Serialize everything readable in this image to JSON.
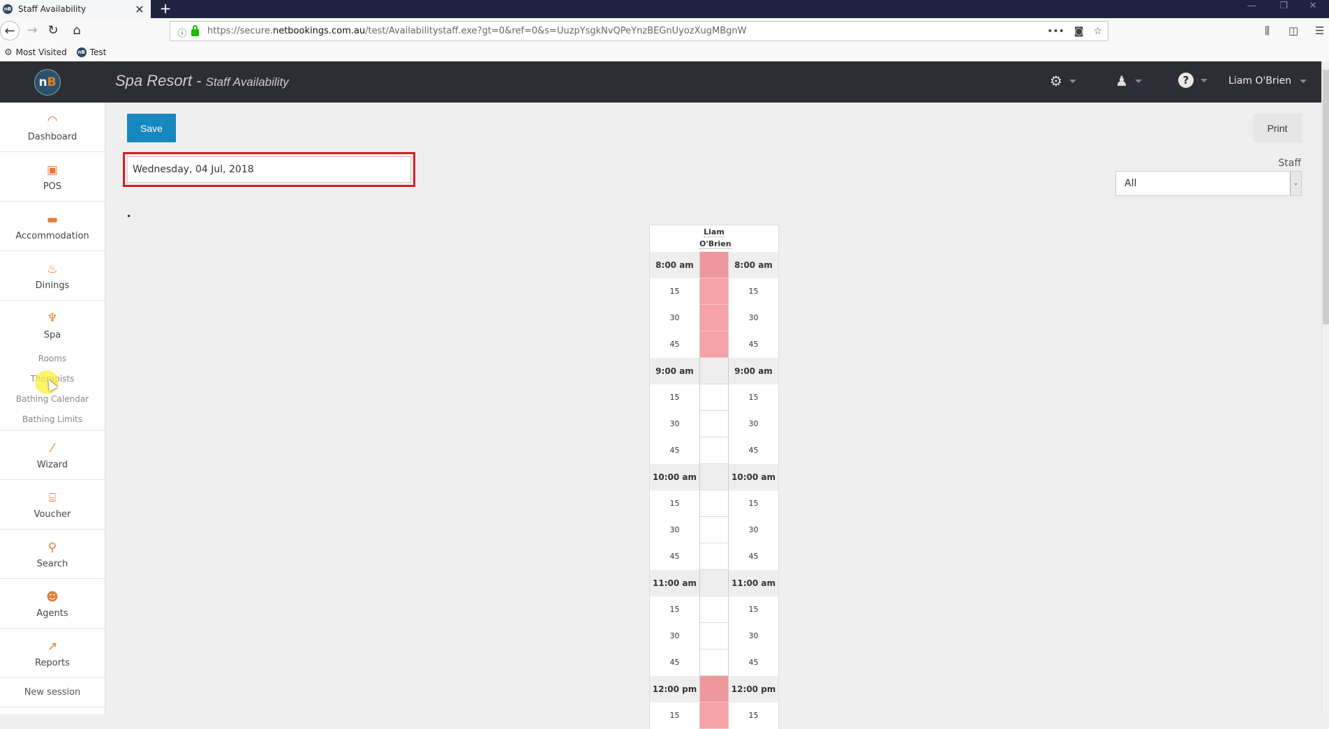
{
  "browser": {
    "tab_title": "Staff Availability",
    "url_prefix": "https://secure.",
    "url_domain": "netbookings.com.au",
    "url_path": "/test/Availabilitystaff.exe?gt=0&ref=0&s=UuzpYsgkNvQPeYnzBEGnUyozXugMBgnW",
    "bookmarks": [
      {
        "label": "Most Visited",
        "icon": "gear-icon"
      },
      {
        "label": "Test",
        "icon": "netbookings-icon"
      }
    ]
  },
  "header": {
    "title": "Spa Resort",
    "separator": " - ",
    "subtitle": "Staff Availability",
    "logo_text_a": "n",
    "logo_text_b": "B",
    "user_name": "Liam O'Brien",
    "icons": [
      "settings-icon",
      "agent-icon",
      "help-icon"
    ]
  },
  "sidebar": {
    "items": [
      {
        "label": "Dashboard",
        "icon": "dashboard-icon",
        "glyph": "◠"
      },
      {
        "label": "POS",
        "icon": "pos-icon",
        "glyph": "▣"
      },
      {
        "label": "Accommodation",
        "icon": "bed-icon",
        "glyph": "▬"
      },
      {
        "label": "Dinings",
        "icon": "dining-icon",
        "glyph": "♨"
      }
    ],
    "spa": {
      "label": "Spa",
      "icon": "spa-icon",
      "glyph": "♆",
      "subitems": [
        "Rooms",
        "Therapists",
        "Bathing Calendar",
        "Bathing Limits"
      ]
    },
    "items_after": [
      {
        "label": "Wizard",
        "icon": "wand-icon",
        "glyph": "⁄"
      },
      {
        "label": "Voucher",
        "icon": "gift-icon",
        "glyph": "⌸"
      },
      {
        "label": "Search",
        "icon": "search-icon",
        "glyph": "⚲"
      },
      {
        "label": "Agents",
        "icon": "agent-icon",
        "glyph": "☻"
      },
      {
        "label": "Reports",
        "icon": "chart-icon",
        "glyph": "↗"
      }
    ],
    "new_session": "New session"
  },
  "main": {
    "save_label": "Save",
    "print_label": "Print",
    "date_value": "Wednesday, 04 Jul, 2018",
    "staff_label": "Staff",
    "staff_selected": "All",
    "dot": "."
  },
  "schedule": {
    "staff_first": "Liam",
    "staff_last": "O'Brien",
    "colors": {
      "unavailable": "#f5a3a6",
      "unavailable_hour": "#ee989b"
    },
    "rows": [
      {
        "time": "8:00 am",
        "hour": true,
        "unavailable": true
      },
      {
        "time": "15",
        "hour": false,
        "unavailable": true
      },
      {
        "time": "30",
        "hour": false,
        "unavailable": true
      },
      {
        "time": "45",
        "hour": false,
        "unavailable": true
      },
      {
        "time": "9:00 am",
        "hour": true,
        "unavailable": false
      },
      {
        "time": "15",
        "hour": false,
        "unavailable": false
      },
      {
        "time": "30",
        "hour": false,
        "unavailable": false
      },
      {
        "time": "45",
        "hour": false,
        "unavailable": false
      },
      {
        "time": "10:00 am",
        "hour": true,
        "unavailable": false
      },
      {
        "time": "15",
        "hour": false,
        "unavailable": false
      },
      {
        "time": "30",
        "hour": false,
        "unavailable": false
      },
      {
        "time": "45",
        "hour": false,
        "unavailable": false
      },
      {
        "time": "11:00 am",
        "hour": true,
        "unavailable": false
      },
      {
        "time": "15",
        "hour": false,
        "unavailable": false
      },
      {
        "time": "30",
        "hour": false,
        "unavailable": false
      },
      {
        "time": "45",
        "hour": false,
        "unavailable": false
      },
      {
        "time": "12:00 pm",
        "hour": true,
        "unavailable": true
      },
      {
        "time": "15",
        "hour": false,
        "unavailable": true
      }
    ]
  }
}
